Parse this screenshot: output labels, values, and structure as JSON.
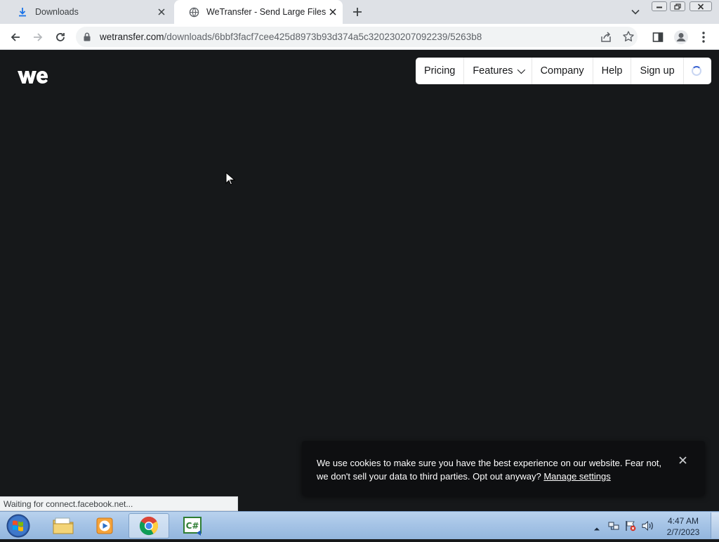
{
  "browser": {
    "tabs": [
      {
        "title": "Downloads",
        "icon": "download-icon",
        "active": false
      },
      {
        "title": "WeTransfer - Send Large Files & Sh",
        "icon": "globe-icon",
        "active": true
      }
    ],
    "url_domain": "wetransfer.com",
    "url_path": "/downloads/6bbf3facf7cee425d8973b93d374a5c320230207092239/5263b8"
  },
  "site": {
    "logo_icon": "wetransfer-logo",
    "nav": {
      "pricing": "Pricing",
      "features": "Features",
      "company": "Company",
      "help": "Help",
      "signup": "Sign up"
    },
    "background_color": "#16181a"
  },
  "cookie_banner": {
    "text": "We use cookies to make sure you have the best experience on our website. Fear not, we don't sell your data to third parties. Opt out anyway?",
    "link": "Manage settings"
  },
  "status_bar": {
    "text": "Waiting for connect.facebook.net..."
  },
  "taskbar": {
    "apps": [
      "start-orb-icon",
      "file-explorer-icon",
      "media-player-icon",
      "chrome-icon",
      "csharp-icon"
    ],
    "clock_time": "4:47 AM",
    "clock_date": "2/7/2023"
  }
}
